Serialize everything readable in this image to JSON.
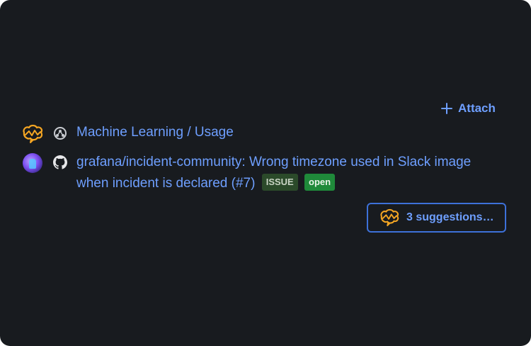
{
  "attach": {
    "label": "Attach",
    "icon": "plus-icon"
  },
  "items": [
    {
      "avatar_icon": "ml-brain-icon",
      "source_icon": "grafana-ml-icon",
      "title": "Machine Learning / Usage"
    },
    {
      "avatar_icon": "user-avatar",
      "source_icon": "github-icon",
      "title": "grafana/incident-community: Wrong timezone used in Slack image when incident is declared (#7)",
      "badges": [
        "ISSUE",
        "open"
      ]
    }
  ],
  "suggestions": {
    "label": "3 suggestions…",
    "icon": "ml-brain-icon"
  },
  "colors": {
    "background": "#181b1f",
    "link": "#6e9fff",
    "button_border": "#3d71d9",
    "badge_issue_bg": "#2b4a2a",
    "badge_open_bg": "#1f8a3a",
    "brain_orange": "#f5a623"
  }
}
